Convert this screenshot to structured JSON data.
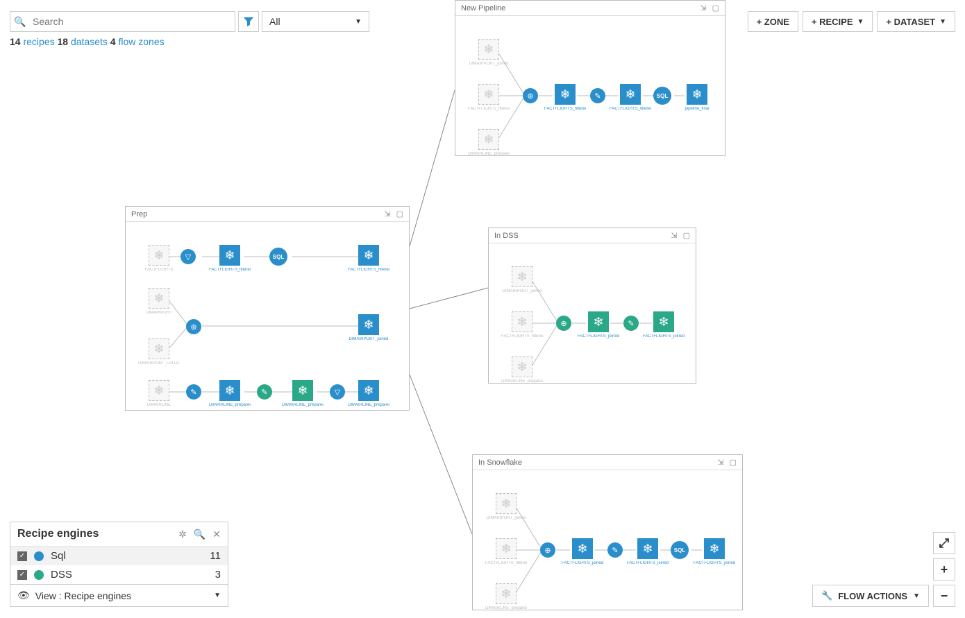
{
  "search": {
    "placeholder": "Search"
  },
  "filter": {
    "selected": "All"
  },
  "counts": {
    "recipes_n": "14",
    "recipes_l": "recipes",
    "datasets_n": "18",
    "datasets_l": "datasets",
    "zones_n": "4",
    "zones_l": "flow zones"
  },
  "buttons": {
    "zone": "+ ZONE",
    "recipe": "+ RECIPE",
    "dataset": "+ DATASET",
    "flow_actions": "FLOW ACTIONS"
  },
  "panel": {
    "title": "Recipe engines",
    "rows": [
      {
        "label": "Sql",
        "count": "11"
      },
      {
        "label": "DSS",
        "count": "3"
      }
    ],
    "view_label": "View : Recipe engines"
  },
  "zones": {
    "prep": {
      "title": "Prep",
      "nodes": {
        "factflights": "FACTFLIGHTS",
        "factflights_filtered": "FACTFLIGHTS_filtered",
        "factflights_filtered_by_region": "FACTFLIGHTS_filtered_by_region",
        "dimairport": "DIMAIRPORT",
        "dimairport_latlon": "DIMAIRPORT_LATLON",
        "dimairport_joined": "DIMAIRPORT_joined",
        "dimairline": "DIMAIRLINE",
        "dimairline_prepared": "DIMAIRLINE_prepared",
        "dimairline_prepared_prepared": "DIMAIRLINE_prepared_prepared",
        "dimairline_prepared_filtered": "DIMAIRLINE_prepared_filtered"
      }
    },
    "new_pipeline": {
      "title": "New Pipeline",
      "nodes": {
        "dimairport_joined": "DIMAIRPORT_joined",
        "factflights_filtered_by_region": "FACTFLIGHTS_filtered_by_region",
        "dimairline_prepared_filtered": "DIMAIRLINE_prepared_filtered",
        "factflights_filtered_joined": "FACTFLIGHTS_filtered_joined",
        "factflights_filtered_joined_prepared": "FACTFLIGHTS_filtered_joined_prepared",
        "pipeline_final": "pipeline_final"
      }
    },
    "in_dss": {
      "title": "In DSS",
      "nodes": {
        "dimairport_joined": "DIMAIRPORT_joined",
        "factflights_filtered_by_region": "FACTFLIGHTS_filtered_by_region",
        "dimairline_prepared_filtered": "DIMAIRLINE_prepared_filtered",
        "factflights_joined": "FACTFLIGHTS_joined",
        "factflights_joined_filtered_prepared": "FACTFLIGHTS_joined_filtered_Prepared"
      }
    },
    "in_snowflake": {
      "title": "In Snowflake",
      "nodes": {
        "dimairport_joined": "DIMAIRPORT_joined",
        "factflights_filtered_by_region": "FACTFLIGHTS_filtered_by_region",
        "dimairline_prepared_filtered": "DIMAIRLINE_prepared_filtered",
        "factflights_joined_sql": "FACTFLIGHTS_joined_SQL",
        "factflights_joined_sql_prepared": "FACTFLIGHTS_joined_SQL_prepared",
        "factflights_joined_sql_final": "FACTFLIGHTS_joined_SQL_final"
      }
    }
  }
}
